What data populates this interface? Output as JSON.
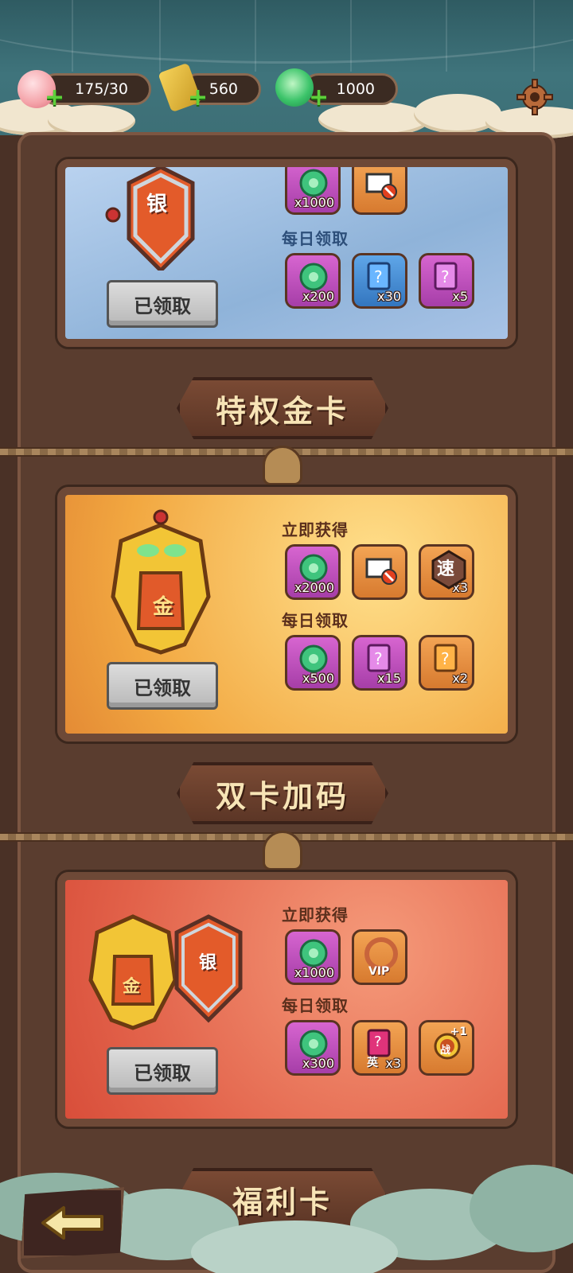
{
  "resources": {
    "stamina": "175/30",
    "tickets": "560",
    "jade": "1000"
  },
  "cards": {
    "silver": {
      "badge_char": "银",
      "instant_items": [
        {
          "icon": "jade-coin-icon",
          "qty": "x1000",
          "style": "purple"
        },
        {
          "icon": "no-ads-tv-icon",
          "qty": "",
          "style": "orange"
        }
      ],
      "daily_label": "每日领取",
      "daily_items": [
        {
          "icon": "jade-coin-icon",
          "qty": "x200",
          "style": "purple"
        },
        {
          "icon": "mystery-blue-card-icon",
          "qty": "x30",
          "style": "blue"
        },
        {
          "icon": "mystery-purple-card-icon",
          "qty": "x5",
          "style": "purple"
        }
      ],
      "button": "已领取"
    },
    "gold_banner": "特权金卡",
    "gold": {
      "badge_char": "金",
      "instant_label": "立即获得",
      "instant_items": [
        {
          "icon": "jade-coin-icon",
          "qty": "x2000",
          "style": "purple"
        },
        {
          "icon": "no-ads-tv-icon",
          "qty": "",
          "style": "orange"
        },
        {
          "icon": "speed-icon",
          "qty": "x3",
          "style": "orange",
          "text": "速"
        }
      ],
      "daily_label": "每日领取",
      "daily_items": [
        {
          "icon": "jade-coin-icon",
          "qty": "x500",
          "style": "purple"
        },
        {
          "icon": "mystery-purple-card-icon",
          "qty": "x15",
          "style": "purple"
        },
        {
          "icon": "mystery-orange-card-icon",
          "qty": "x2",
          "style": "orange"
        }
      ],
      "button": "已领取"
    },
    "double_banner": "双卡加码",
    "double": {
      "badge_chars": [
        "金",
        "银"
      ],
      "instant_label": "立即获得",
      "instant_items": [
        {
          "icon": "jade-coin-icon",
          "qty": "x1000",
          "style": "purple"
        },
        {
          "icon": "vip-frame-icon",
          "qty": "",
          "style": "orange",
          "text": "VIP"
        }
      ],
      "daily_label": "每日领取",
      "daily_items": [
        {
          "icon": "jade-coin-icon",
          "qty": "x300",
          "style": "purple"
        },
        {
          "icon": "hero-card-icon",
          "qty": "x3",
          "style": "orange",
          "text": "英"
        },
        {
          "icon": "battle-plus-icon",
          "qty": "+1",
          "style": "orange",
          "text": "战"
        }
      ],
      "button": "已领取"
    },
    "welfare_banner": "福利卡"
  },
  "colors": {
    "bg": "#4a3126",
    "green_plus": "#5dd13a",
    "banner_text": "#f7e4b6"
  }
}
